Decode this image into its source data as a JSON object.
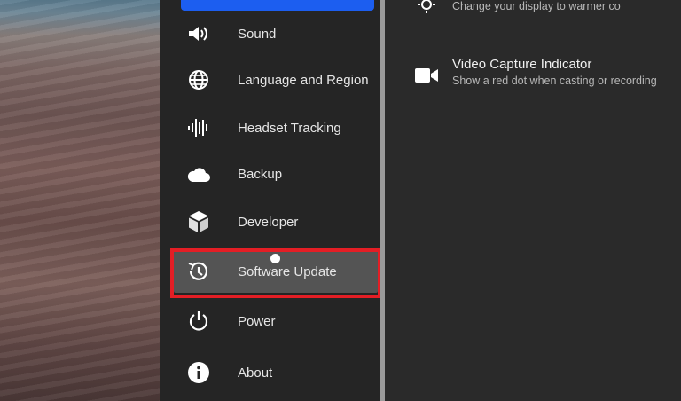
{
  "sidebar": {
    "items": [
      {
        "label": "Sound",
        "icon": "speaker-icon"
      },
      {
        "label": "Language and Region",
        "icon": "globe-icon"
      },
      {
        "label": "Headset Tracking",
        "icon": "waveform-icon"
      },
      {
        "label": "Backup",
        "icon": "cloud-icon"
      },
      {
        "label": "Developer",
        "icon": "cube-icon"
      },
      {
        "label": "Software Update",
        "icon": "clock-update-icon",
        "selected": true
      },
      {
        "label": "Power",
        "icon": "power-icon"
      },
      {
        "label": "About",
        "icon": "info-icon"
      }
    ]
  },
  "content": {
    "top_setting": {
      "subtitle": "Change your display to warmer co"
    },
    "video_capture": {
      "title": "Video Capture Indicator",
      "subtitle": "Show a red dot when casting or recording"
    }
  },
  "colors": {
    "accent": "#1c5ef0",
    "highlight": "#e41e25",
    "selected_bg": "#545454",
    "panel_bg": "#252525"
  }
}
